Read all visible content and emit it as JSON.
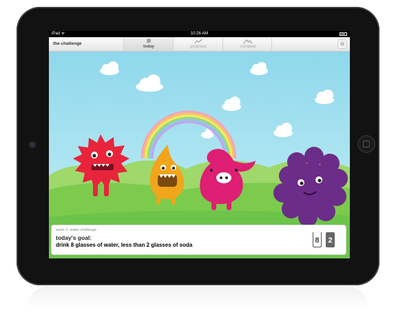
{
  "status_bar": {
    "carrier": "iPad ᯤ",
    "time": "10:26 AM"
  },
  "app": {
    "title": "the challenge"
  },
  "tabs": [
    {
      "label": "today",
      "icon": "calendar-icon",
      "active": true
    },
    {
      "label": "progress",
      "icon": "line-chart-icon",
      "active": false
    },
    {
      "label": "compete",
      "icon": "mountains-icon",
      "active": false
    }
  ],
  "settings_icon": "gear-icon",
  "goal": {
    "week_label": "week 1: water challenge",
    "title": "today's goal:",
    "text": "drink 8 glasses of water, less than 2 glasses of soda",
    "water_count": "8",
    "soda_count": "2"
  },
  "colors": {
    "sky": "#9fe0ef",
    "grass": "#6cc44a",
    "red_monster": "#e8243b",
    "yellow_monster": "#f2a51a",
    "pink_monster": "#de1f73",
    "purple_monster": "#6b2d87"
  }
}
